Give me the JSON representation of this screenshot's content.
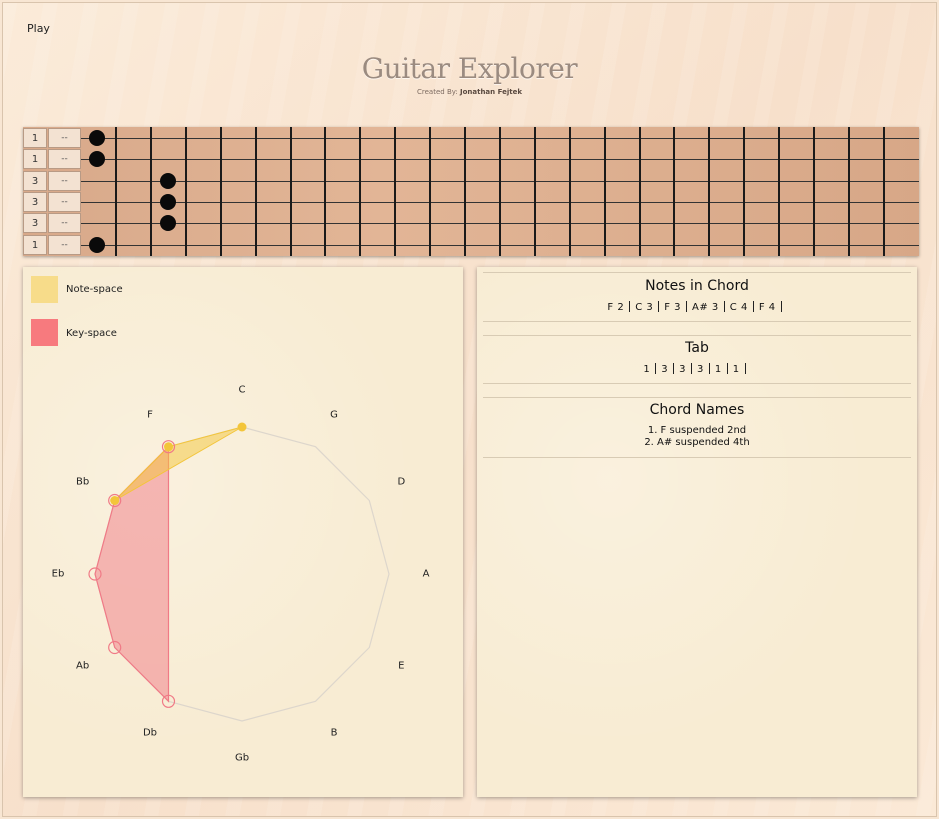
{
  "header": {
    "play_label": "Play",
    "title": "Guitar Explorer",
    "credit_prefix": "Created By:",
    "credit_name": "Jonathan Fejtek"
  },
  "fretboard": {
    "strings": [
      {
        "finger": "1",
        "option": "--",
        "fret": 0
      },
      {
        "finger": "1",
        "option": "--",
        "fret": 0
      },
      {
        "finger": "3",
        "option": "--",
        "fret": 2
      },
      {
        "finger": "3",
        "option": "--",
        "fret": 2
      },
      {
        "finger": "3",
        "option": "--",
        "fret": 2
      },
      {
        "finger": "1",
        "option": "--",
        "fret": 0
      }
    ],
    "fret_count": 23
  },
  "legend": {
    "note_space": {
      "label": "Note-space",
      "color": "#f7dc8a"
    },
    "key_space": {
      "label": "Key-space",
      "color": "#f77a7e"
    }
  },
  "circle": {
    "notes": [
      "C",
      "G",
      "D",
      "A",
      "E",
      "B",
      "Gb",
      "Db",
      "Ab",
      "Eb",
      "Bb",
      "F"
    ],
    "note_space_indices": [
      0,
      11,
      10
    ],
    "key_space_indices": [
      11,
      10,
      9,
      8,
      7
    ],
    "colors": {
      "note": "#f3c53a",
      "key": "#f07a86",
      "ring": "#e2a7b0",
      "outline": "#ddd6cc"
    }
  },
  "notes_section": {
    "title": "Notes in Chord",
    "notes": [
      "F 2",
      "C 3",
      "F 3",
      "A# 3",
      "C 4",
      "F 4"
    ]
  },
  "tab_section": {
    "title": "Tab",
    "values": [
      "1",
      "3",
      "3",
      "3",
      "1",
      "1"
    ]
  },
  "chords_section": {
    "title": "Chord Names",
    "names": [
      "1. F suspended 2nd",
      "2. A# suspended 4th"
    ]
  }
}
